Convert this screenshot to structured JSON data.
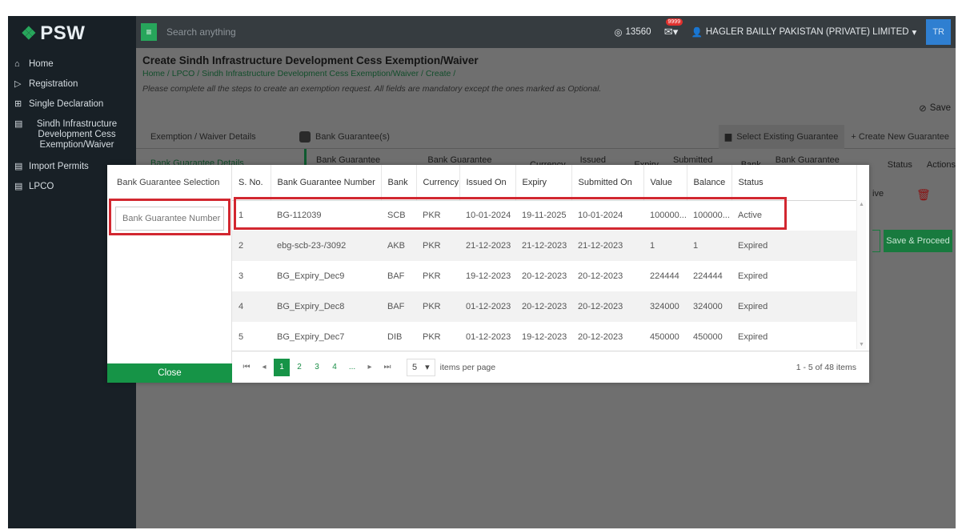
{
  "sidebar": {
    "logo": "PSW",
    "items": [
      {
        "icon": "home-icon",
        "glyph": "⌂",
        "label": "Home"
      },
      {
        "icon": "registration-icon",
        "glyph": "▷",
        "label": "Registration"
      },
      {
        "icon": "single-declaration-icon",
        "glyph": "⊞",
        "label": "Single Declaration"
      },
      {
        "icon": "document-icon",
        "glyph": "▤",
        "label": "Sindh Infrastructure Development Cess Exemption/Waiver"
      },
      {
        "icon": "document-icon",
        "glyph": "▤",
        "label": "Import Permits"
      },
      {
        "icon": "document-icon",
        "glyph": "▤",
        "label": "LPCO"
      }
    ]
  },
  "topbar": {
    "search_placeholder": "Search anything",
    "counter": "13560",
    "badge": "9999",
    "org": "HAGLER BAILLY PAKISTAN (PRIVATE) LIMITED",
    "user_initials": "TR"
  },
  "page": {
    "title": "Create Sindh Infrastructure Development Cess Exemption/Waiver",
    "breadcrumb": "Home / LPCO / Sindh Infrastructure Development Cess Exemption/Waiver / Create /",
    "hint": "Please complete all the steps to create an exemption request. All fields are mandatory except the ones marked as Optional.",
    "save_label": "Save",
    "tab_exemption": "Exemption / Waiver Details",
    "tab_bank_guarantees": "Bank Guarantee(s)",
    "tab_select_existing": "Select Existing Guarantee",
    "tab_create_new": "+ Create New Guarantee",
    "left_item": "Bank Guarantee Details",
    "bg_headers": [
      "Bank Guarantee Number",
      "Bank Guarantee Value",
      "Currency",
      "Issued On",
      "Expiry",
      "Submitted On",
      "Bank",
      "Bank Guarantee Balance",
      "Status",
      "Actions"
    ],
    "bg_row_status": "ive",
    "save_proceed": "Save & Proceed"
  },
  "modal": {
    "left_label": "Bank Guarantee Selection",
    "input_placeholder": "Bank Guarantee Number",
    "close_label": "Close",
    "columns": [
      "S. No.",
      "Bank Guarantee Number",
      "Bank",
      "Currency",
      "Issued On",
      "Expiry",
      "Submitted On",
      "Value",
      "Balance",
      "Status"
    ],
    "rows": [
      [
        "1",
        "BG-112039",
        "SCB",
        "PKR",
        "10-01-2024",
        "19-11-2025",
        "10-01-2024",
        "100000...",
        "100000...",
        "Active"
      ],
      [
        "2",
        "ebg-scb-23-/3092",
        "AKB",
        "PKR",
        "21-12-2023",
        "21-12-2023",
        "21-12-2023",
        "1",
        "1",
        "Expired"
      ],
      [
        "3",
        "BG_Expiry_Dec9",
        "BAF",
        "PKR",
        "19-12-2023",
        "20-12-2023",
        "20-12-2023",
        "224444",
        "224444",
        "Expired"
      ],
      [
        "4",
        "BG_Expiry_Dec8",
        "BAF",
        "PKR",
        "01-12-2023",
        "20-12-2023",
        "20-12-2023",
        "324000",
        "324000",
        "Expired"
      ],
      [
        "5",
        "BG_Expiry_Dec7",
        "DIB",
        "PKR",
        "01-12-2023",
        "19-12-2023",
        "20-12-2023",
        "450000",
        "450000",
        "Expired"
      ]
    ],
    "pager": {
      "pages": [
        "1",
        "2",
        "3",
        "4",
        "..."
      ],
      "current_page": "1",
      "per_page": "5",
      "per_page_label": "items per page",
      "range": "1 - 5 of 48 items"
    }
  },
  "colors": {
    "accent": "#169447",
    "highlight": "#d22730",
    "sidebar": "#182026"
  }
}
